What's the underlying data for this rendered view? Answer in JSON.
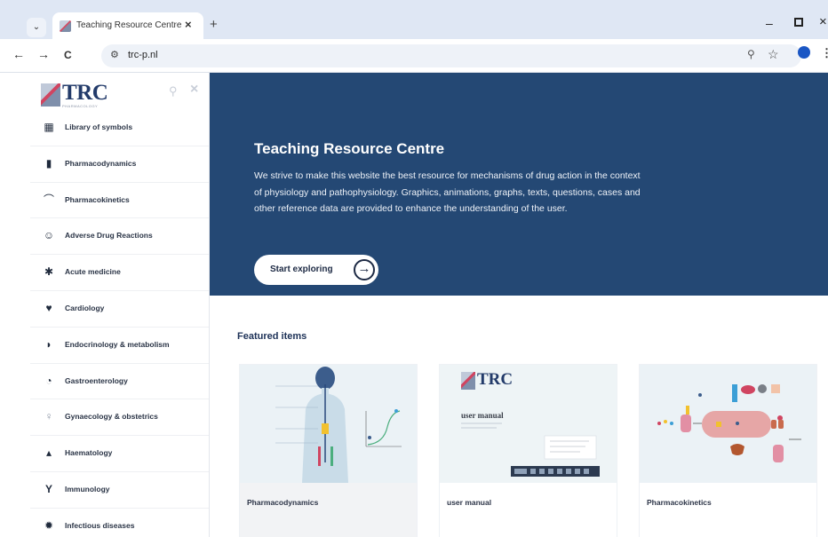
{
  "browser": {
    "tab_title": "Teaching Resource Centre",
    "tab_close": "×",
    "new_tab": "+",
    "tab_menu": "⌄",
    "url": "trc-p.nl",
    "back": "←",
    "forward": "→",
    "reload": "C",
    "window_min": "–",
    "window_close": "×"
  },
  "sidebar": {
    "logo_text": "TRC",
    "logo_sub": "PHARMACOLOGY",
    "items": [
      {
        "label": "Library of symbols",
        "icon": "grid-icon"
      },
      {
        "label": "Pharmacodynamics",
        "icon": "pharmacodynamics-icon"
      },
      {
        "label": "Pharmacokinetics",
        "icon": "curve-icon"
      },
      {
        "label": "Adverse Drug Reactions",
        "icon": "person-alert-icon"
      },
      {
        "label": "Acute medicine",
        "icon": "gear-icon"
      },
      {
        "label": "Cardiology",
        "icon": "heart-icon"
      },
      {
        "label": "Endocrinology & metabolism",
        "icon": "thyroid-icon"
      },
      {
        "label": "Gastroenterology",
        "icon": "stomach-icon"
      },
      {
        "label": "Gynaecology & obstetrics",
        "icon": "female-icon"
      },
      {
        "label": "Haematology",
        "icon": "drop-icon"
      },
      {
        "label": "Immunology",
        "icon": "antibody-icon"
      },
      {
        "label": "Infectious diseases",
        "icon": "virus-icon"
      }
    ]
  },
  "hero": {
    "title": "Teaching Resource Centre",
    "text": "We strive to make this website the best resource for mechanisms of drug action in the context of physiology and pathophysiology. Graphics, animations, graphs, texts, questions, cases and other reference data are provided to enhance the understanding of the user.",
    "cta_label": "Start exploring"
  },
  "featured": {
    "title": "Featured items",
    "cards": [
      {
        "label": "Pharmacodynamics"
      },
      {
        "label": "user manual",
        "thumb_logo": "TRC",
        "thumb_title": "user manual"
      },
      {
        "label": "Pharmacokinetics"
      }
    ]
  },
  "colors": {
    "hero_bg": "#244874",
    "accent": "#d04561",
    "text_dark": "#2a3446"
  }
}
